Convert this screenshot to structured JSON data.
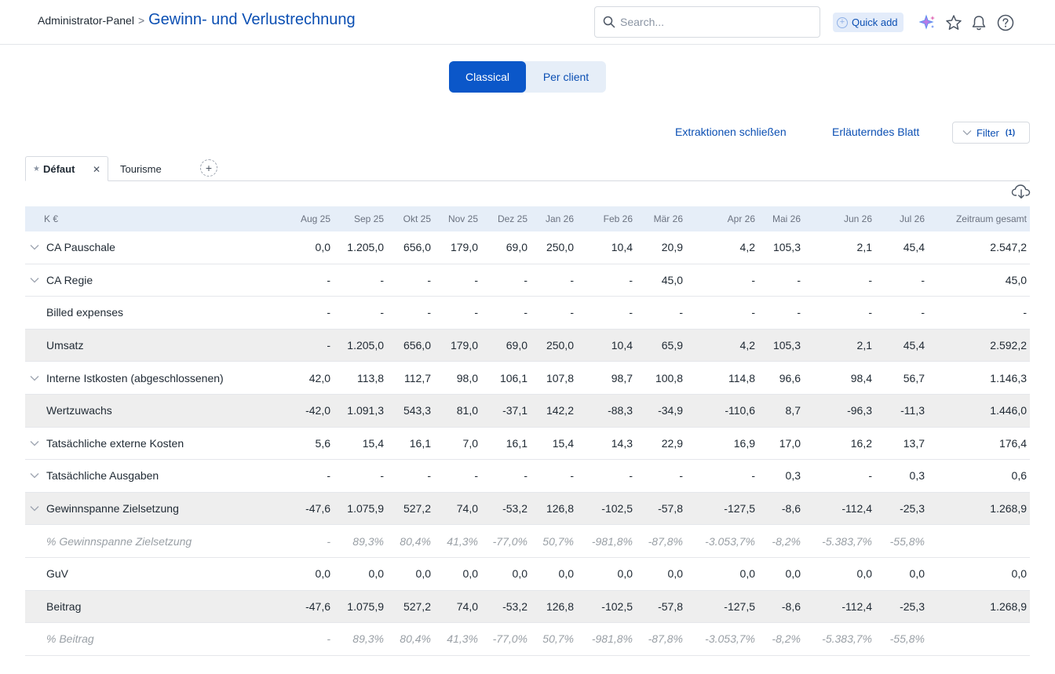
{
  "breadcrumb": {
    "parent": "Administrator-Panel",
    "separator": ">",
    "title": "Gewinn- und Verlustrechnung"
  },
  "search": {
    "placeholder": "Search..."
  },
  "quick_add": {
    "label": "Quick add"
  },
  "top_icons": [
    "sparkle-icon",
    "star-icon",
    "bell-icon",
    "help-icon"
  ],
  "view_toggle": {
    "options": [
      "Classical",
      "Per client"
    ],
    "selected": "Classical"
  },
  "actions": {
    "close_extractions": "Extraktionen schließen",
    "explanatory_sheet": "Erläuterndes Blatt",
    "filter_label": "Filter",
    "filter_count": "(1)"
  },
  "tabs": [
    {
      "label": "Défaut",
      "pinned": true,
      "active": true
    },
    {
      "label": "Tourisme",
      "active": false
    }
  ],
  "colors": {
    "accent": "#0b57c9",
    "link": "#0b4fb3",
    "header_bg": "#e6eef8",
    "row_shade": "#eeeeee"
  },
  "table": {
    "unit_header": "K €",
    "columns": [
      "Aug 25",
      "Sep 25",
      "Okt 25",
      "Nov 25",
      "Dez 25",
      "Jan 26",
      "Feb 26",
      "Mär 26",
      "Apr 26",
      "Mai 26",
      "Jun 26",
      "Jul 26",
      "Zeitraum gesamt"
    ],
    "rows": [
      {
        "label": "CA Pauschale",
        "expandable": true,
        "shaded": false,
        "style": "normal",
        "values": [
          "0,0",
          "1.205,0",
          "656,0",
          "179,0",
          "69,0",
          "250,0",
          "10,4",
          "20,9",
          "4,2",
          "105,3",
          "2,1",
          "45,4",
          "2.547,2"
        ]
      },
      {
        "label": "CA Regie",
        "expandable": true,
        "shaded": false,
        "style": "normal",
        "values": [
          "-",
          "-",
          "-",
          "-",
          "-",
          "-",
          "-",
          "45,0",
          "-",
          "-",
          "-",
          "-",
          "45,0"
        ]
      },
      {
        "label": "Billed expenses",
        "expandable": false,
        "shaded": false,
        "style": "normal",
        "values": [
          "-",
          "-",
          "-",
          "-",
          "-",
          "-",
          "-",
          "-",
          "-",
          "-",
          "-",
          "-",
          "-"
        ]
      },
      {
        "label": "Umsatz",
        "expandable": false,
        "shaded": true,
        "style": "normal",
        "values": [
          "-",
          "1.205,0",
          "656,0",
          "179,0",
          "69,0",
          "250,0",
          "10,4",
          "65,9",
          "4,2",
          "105,3",
          "2,1",
          "45,4",
          "2.592,2"
        ]
      },
      {
        "label": "Interne Istkosten (abgeschlossenen)",
        "expandable": true,
        "shaded": false,
        "style": "normal",
        "values": [
          "42,0",
          "113,8",
          "112,7",
          "98,0",
          "106,1",
          "107,8",
          "98,7",
          "100,8",
          "114,8",
          "96,6",
          "98,4",
          "56,7",
          "1.146,3"
        ]
      },
      {
        "label": "Wertzuwachs",
        "expandable": false,
        "shaded": true,
        "style": "normal",
        "values": [
          "-42,0",
          "1.091,3",
          "543,3",
          "81,0",
          "-37,1",
          "142,2",
          "-88,3",
          "-34,9",
          "-110,6",
          "8,7",
          "-96,3",
          "-11,3",
          "1.446,0"
        ]
      },
      {
        "label": "Tatsächliche externe Kosten",
        "expandable": true,
        "shaded": false,
        "style": "normal",
        "values": [
          "5,6",
          "15,4",
          "16,1",
          "7,0",
          "16,1",
          "15,4",
          "14,3",
          "22,9",
          "16,9",
          "17,0",
          "16,2",
          "13,7",
          "176,4"
        ]
      },
      {
        "label": "Tatsächliche Ausgaben",
        "expandable": true,
        "shaded": false,
        "style": "normal",
        "values": [
          "-",
          "-",
          "-",
          "-",
          "-",
          "-",
          "-",
          "-",
          "-",
          "0,3",
          "-",
          "0,3",
          "0,6"
        ]
      },
      {
        "label": "Gewinnspanne Zielsetzung",
        "expandable": true,
        "shaded": true,
        "style": "normal",
        "values": [
          "-47,6",
          "1.075,9",
          "527,2",
          "74,0",
          "-53,2",
          "126,8",
          "-102,5",
          "-57,8",
          "-127,5",
          "-8,6",
          "-112,4",
          "-25,3",
          "1.268,9"
        ]
      },
      {
        "label": "% Gewinnspanne Zielsetzung",
        "expandable": false,
        "shaded": false,
        "style": "percent",
        "values": [
          "-",
          "89,3%",
          "80,4%",
          "41,3%",
          "-77,0%",
          "50,7%",
          "-981,8%",
          "-87,8%",
          "-3.053,7%",
          "-8,2%",
          "-5.383,7%",
          "-55,8%",
          ""
        ]
      },
      {
        "label": "GuV",
        "expandable": false,
        "shaded": false,
        "style": "normal",
        "values": [
          "0,0",
          "0,0",
          "0,0",
          "0,0",
          "0,0",
          "0,0",
          "0,0",
          "0,0",
          "0,0",
          "0,0",
          "0,0",
          "0,0",
          "0,0"
        ]
      },
      {
        "label": "Beitrag",
        "expandable": false,
        "shaded": true,
        "style": "normal",
        "values": [
          "-47,6",
          "1.075,9",
          "527,2",
          "74,0",
          "-53,2",
          "126,8",
          "-102,5",
          "-57,8",
          "-127,5",
          "-8,6",
          "-112,4",
          "-25,3",
          "1.268,9"
        ]
      },
      {
        "label": "% Beitrag",
        "expandable": false,
        "shaded": false,
        "style": "percent",
        "values": [
          "-",
          "89,3%",
          "80,4%",
          "41,3%",
          "-77,0%",
          "50,7%",
          "-981,8%",
          "-87,8%",
          "-3.053,7%",
          "-8,2%",
          "-5.383,7%",
          "-55,8%",
          ""
        ]
      }
    ]
  }
}
